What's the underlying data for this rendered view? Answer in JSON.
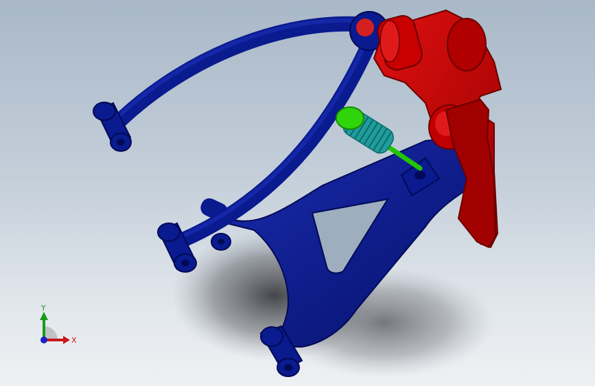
{
  "viewport": {
    "background_top": "#a9b8c8",
    "background_bottom": "#eef1f3"
  },
  "model": {
    "parts": [
      {
        "name": "upper-wishbone",
        "color": "#0a1a8f"
      },
      {
        "name": "lower-control-arm",
        "color": "#0a1a8f"
      },
      {
        "name": "steering-knuckle",
        "color": "#c40000"
      },
      {
        "name": "coilover-shock",
        "spring_color": "#1fa3a3",
        "body_color": "#22c400"
      }
    ]
  },
  "triad": {
    "y_label": "Y",
    "x_label": "X",
    "y_color": "#1a9a1a",
    "x_color": "#c81818",
    "z_color": "#1820c8"
  }
}
